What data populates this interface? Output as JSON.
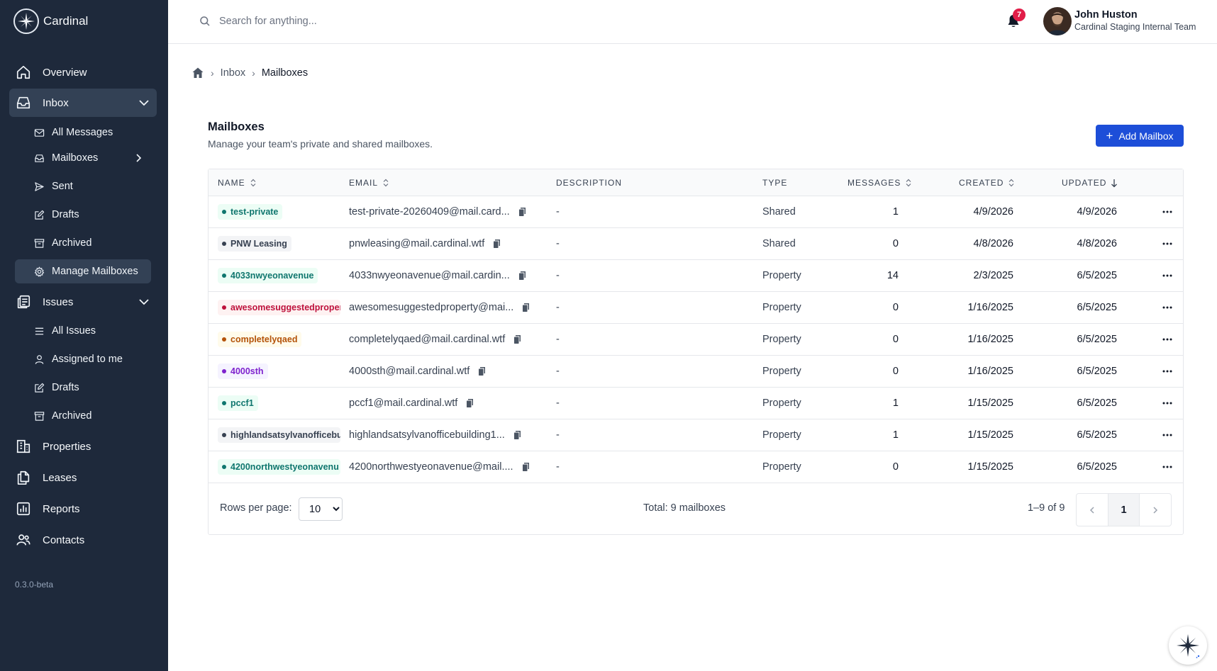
{
  "app": {
    "name": "Cardinal",
    "version": "0.3.0-beta"
  },
  "sidebar": {
    "overview": "Overview",
    "inbox": {
      "label": "Inbox",
      "items": [
        "All Messages",
        "Mailboxes",
        "Sent",
        "Drafts",
        "Archived",
        "Manage Mailboxes"
      ]
    },
    "issues": {
      "label": "Issues",
      "items": [
        "All Issues",
        "Assigned to me",
        "Drafts",
        "Archived"
      ]
    },
    "properties": "Properties",
    "leases": "Leases",
    "reports": "Reports",
    "contacts": "Contacts"
  },
  "header": {
    "search_placeholder": "Search for anything...",
    "notification_count": "7",
    "user": {
      "name": "John Huston",
      "team": "Cardinal Staging Internal Team"
    }
  },
  "breadcrumb": {
    "parent": "Inbox",
    "current": "Mailboxes"
  },
  "page": {
    "title": "Mailboxes",
    "subtitle": "Manage your team's private and shared mailboxes.",
    "add_button": "Add Mailbox"
  },
  "table": {
    "columns": {
      "name": "NAME",
      "email": "EMAIL",
      "description": "DESCRIPTION",
      "type": "TYPE",
      "messages": "MESSAGES",
      "created": "CREATED",
      "updated": "UPDATED"
    },
    "rows": [
      {
        "name": "test-private",
        "email": "test-private-20260409@mail.card...",
        "description": "-",
        "type": "Shared",
        "messages": "1",
        "created": "4/9/2026",
        "updated": "4/9/2026",
        "color": "teal"
      },
      {
        "name": "PNW Leasing",
        "email": "pnwleasing@mail.cardinal.wtf",
        "description": "-",
        "type": "Shared",
        "messages": "0",
        "created": "4/8/2026",
        "updated": "4/8/2026",
        "color": "gray"
      },
      {
        "name": "4033nwyeonavenue",
        "email": "4033nwyeonavenue@mail.cardin...",
        "description": "-",
        "type": "Property",
        "messages": "14",
        "created": "2/3/2025",
        "updated": "6/5/2025",
        "color": "teal"
      },
      {
        "name": "awesomesuggestedproper",
        "email": "awesomesuggestedproperty@mai...",
        "description": "-",
        "type": "Property",
        "messages": "0",
        "created": "1/16/2025",
        "updated": "6/5/2025",
        "color": "red"
      },
      {
        "name": "completelyqaed",
        "email": "completelyqaed@mail.cardinal.wtf",
        "description": "-",
        "type": "Property",
        "messages": "0",
        "created": "1/16/2025",
        "updated": "6/5/2025",
        "color": "orange"
      },
      {
        "name": "4000sth",
        "email": "4000sth@mail.cardinal.wtf",
        "description": "-",
        "type": "Property",
        "messages": "0",
        "created": "1/16/2025",
        "updated": "6/5/2025",
        "color": "purple"
      },
      {
        "name": "pccf1",
        "email": "pccf1@mail.cardinal.wtf",
        "description": "-",
        "type": "Property",
        "messages": "1",
        "created": "1/15/2025",
        "updated": "6/5/2025",
        "color": "teal"
      },
      {
        "name": "highlandsatsylvanofficebu",
        "email": "highlandsatsylvanofficebuilding1...",
        "description": "-",
        "type": "Property",
        "messages": "1",
        "created": "1/15/2025",
        "updated": "6/5/2025",
        "color": "gray"
      },
      {
        "name": "4200northwestyeonavenu",
        "email": "4200northwestyeonavenue@mail....",
        "description": "-",
        "type": "Property",
        "messages": "0",
        "created": "1/15/2025",
        "updated": "6/5/2025",
        "color": "teal"
      }
    ],
    "footer": {
      "rows_per_page_label": "Rows per page:",
      "rows_per_page": "10",
      "total": "Total: 9 mailboxes",
      "range": "1–9 of 9",
      "page": "1"
    }
  },
  "colors": {
    "sidebar_bg": "#1e293b",
    "accent": "#1d4ed8",
    "badge": "#e11d48",
    "chip_teal_bg": "#ecfdf5",
    "chip_teal_fg": "#0f766e",
    "chip_gray_bg": "#f3f4f6",
    "chip_gray_fg": "#374151",
    "chip_red_bg": "#fef2f2",
    "chip_red_fg": "#be123c",
    "chip_orange_bg": "#fffbeb",
    "chip_orange_fg": "#b45309",
    "chip_purple_bg": "#f5f3ff",
    "chip_purple_fg": "#7e22ce"
  },
  "icons": {
    "overview": "home-icon",
    "inbox": "inbox-icon",
    "issues": "issues-icon",
    "properties": "building-icon",
    "leases": "document-icon",
    "reports": "chart-icon",
    "contacts": "users-icon",
    "search": "search-icon",
    "bell": "bell-icon"
  }
}
